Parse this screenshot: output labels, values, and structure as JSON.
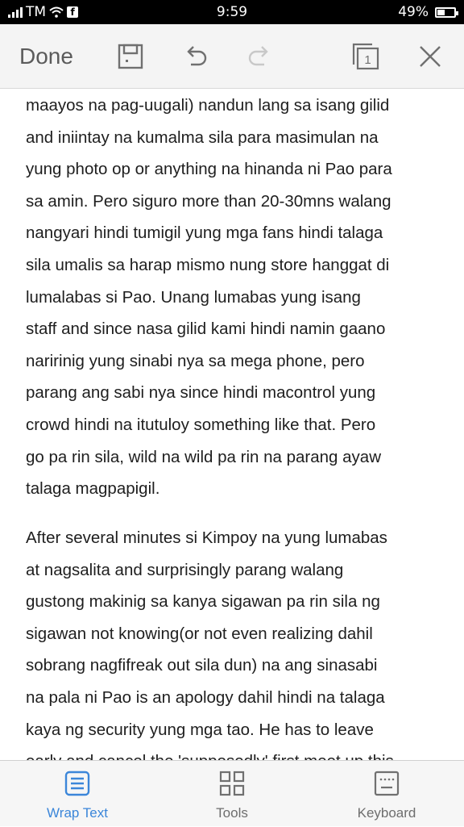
{
  "status_bar": {
    "carrier": "TM",
    "time": "9:59",
    "battery": "49%",
    "battery_level": 0.49
  },
  "toolbar": {
    "done_label": "Done",
    "page_count": "1"
  },
  "document": {
    "paragraphs": [
      {
        "lines": [
          "maayos na pag-uugali) nandun lang sa isang gilid",
          "and iniintay na kumalma sila para masimulan na",
          "yung photo op or anything na hinanda ni Pao para",
          "sa amin. Pero siguro more than 20-30mns walang",
          "nangyari hindi tumigil yung mga fans hindi talaga",
          "sila umalis sa harap mismo nung store hanggat di",
          "lumalabas si Pao. Unang lumabas yung isang",
          "staff and since nasa gilid kami hindi namin gaano",
          "naririnig yung sinabi nya sa mega phone, pero",
          "parang ang sabi nya since hindi macontrol yung",
          "crowd hindi na itutuloy something like that. Pero",
          "go pa rin sila, wild na wild pa rin na parang ayaw",
          "talaga magpapigil."
        ]
      },
      {
        "lines": [
          "After several minutes si Kimpoy na yung lumabas",
          "at nagsalita and surprisingly parang walang",
          "gustong makinig sa kanya sigawan pa rin sila ng",
          "sigawan not knowing(or not even realizing dahil",
          "sobrang nagfifreak out sila dun) na ang sinasabi",
          "na pala ni Pao is an apology dahil hindi na talaga",
          "kaya ng security yung mga tao. He has to leave",
          "early and cancel the 'supposedly' first meet up this"
        ]
      }
    ]
  },
  "bottom_bar": {
    "items": [
      {
        "label": "Wrap Text",
        "icon": "wrap-text-icon",
        "active": true
      },
      {
        "label": "Tools",
        "icon": "grid-tools-icon",
        "active": false
      },
      {
        "label": "Keyboard",
        "icon": "keyboard-icon",
        "active": false
      }
    ]
  },
  "colors": {
    "accent": "#3b86d9",
    "toolbar_bg": "#f4f4f4",
    "text": "#1e1e1e",
    "icon": "#707070"
  }
}
